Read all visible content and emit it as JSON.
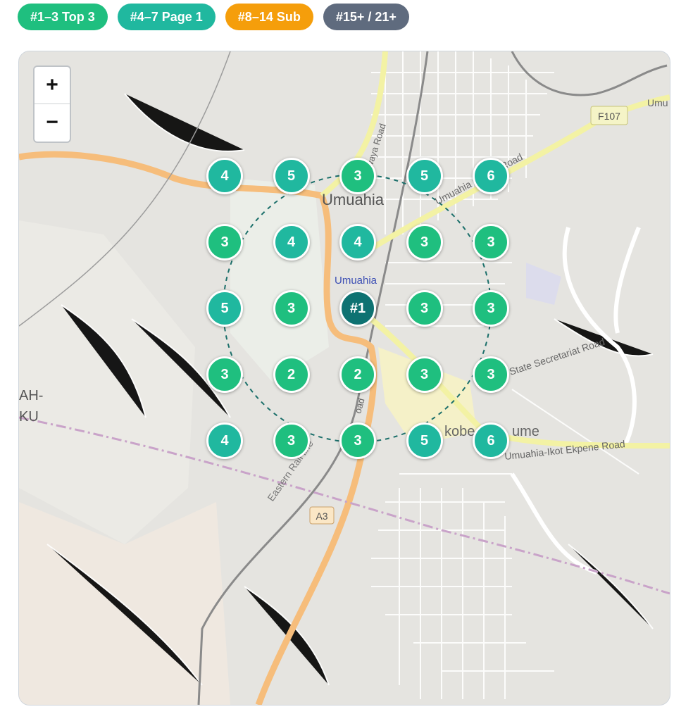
{
  "legend": [
    {
      "label": "#1–3 Top 3",
      "color": "#1fbf7f"
    },
    {
      "label": "#4–7 Page 1",
      "color": "#20b89f"
    },
    {
      "label": "#8–14 Sub",
      "color": "#f59e0b"
    },
    {
      "label": "#15+ / 21+",
      "color": "#5f6b7e"
    }
  ],
  "zoom": {
    "in_label": "+",
    "out_label": "−"
  },
  "colors": {
    "top3": "#1fbf7f",
    "page1": "#20b89f",
    "center": "#0e7272"
  },
  "grid": [
    [
      "4",
      "5",
      "3",
      "5",
      "6"
    ],
    [
      "3",
      "4",
      "4",
      "3",
      "3"
    ],
    [
      "5",
      "3",
      "#1",
      "3",
      "3"
    ],
    [
      "3",
      "2",
      "2",
      "3",
      "3"
    ],
    [
      "4",
      "3",
      "3",
      "5",
      "6"
    ]
  ],
  "labels": {
    "city": "Umuahia",
    "center_place": "Umuahia",
    "ohafia_road": "Umuahia Ohafia Road",
    "uwaya_road": "Uwaya Road",
    "state_secretariat": "State Secretariat Road",
    "ikot_ekpene": "Umuahia-Ikot Ekpene Road",
    "railway": "Eastern Rail line",
    "a3": "A3",
    "f107": "F107",
    "umu": "Umu",
    "ikobe": "kobe",
    "ume": "ume",
    "ahku_top": "AH-",
    "ahku_bottom": "KU",
    "road_d": "oad"
  }
}
